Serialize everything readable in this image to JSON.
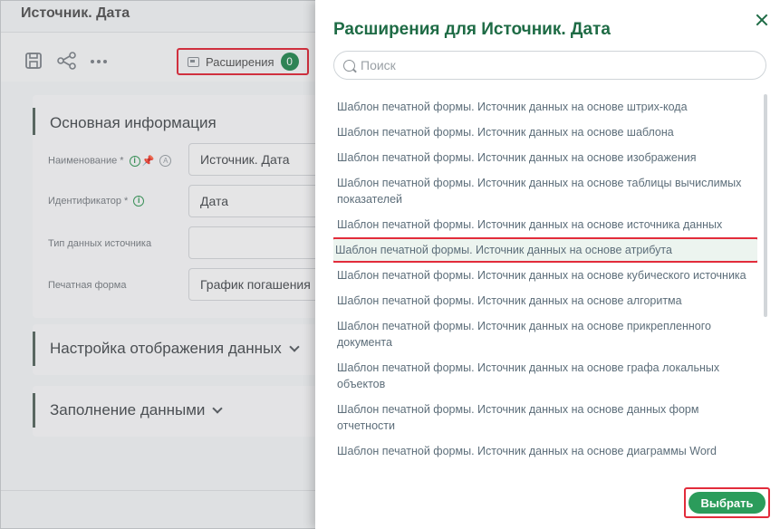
{
  "page": {
    "title": "Источник. Дата",
    "toolbar": {
      "save_icon": "save-icon",
      "share_icon": "share-icon",
      "more_icon": "more-icon",
      "extensions_label": "Расширения",
      "extensions_count": "0"
    },
    "sections": {
      "main": {
        "title": "Основная информация",
        "fields": [
          {
            "label": "Наименование *",
            "value": "Источник. Дата"
          },
          {
            "label": "Идентификатор *",
            "value": "Дата"
          },
          {
            "label": "Тип данных источника",
            "value": ""
          },
          {
            "label": "Печатная форма",
            "value": "График погашения"
          }
        ]
      },
      "display": {
        "title": "Настройка отображения данных"
      },
      "fill": {
        "title": "Заполнение данными"
      }
    }
  },
  "dialog": {
    "title": "Расширения для Источник. Дата",
    "search_placeholder": "Поиск",
    "items": [
      "Шаблон печатной формы. Источник данных на основе штрих-кода",
      "Шаблон печатной формы. Источник данных на основе шаблона",
      "Шаблон печатной формы. Источник данных на основе изображения",
      "Шаблон печатной формы. Источник данных на основе таблицы вычислимых показателей",
      "Шаблон печатной формы. Источник данных на основе источника данных",
      "Шаблон печатной формы. Источник данных на основе атрибута",
      "Шаблон печатной формы. Источник данных на основе кубического источника",
      "Шаблон печатной формы. Источник данных на основе алгоритма",
      "Шаблон печатной формы. Источник данных на основе прикрепленного документа",
      "Шаблон печатной формы. Источник данных на основе графа локальных объектов",
      "Шаблон печатной формы. Источник данных на основе данных форм отчетности",
      "Шаблон печатной формы. Источник данных на основе диаграммы Word"
    ],
    "selected_index": 5,
    "select_label": "Выбрать"
  },
  "colors": {
    "accent": "#2b9c5b",
    "title_green": "#1e6b45",
    "highlight_red": "#e22c3b"
  }
}
